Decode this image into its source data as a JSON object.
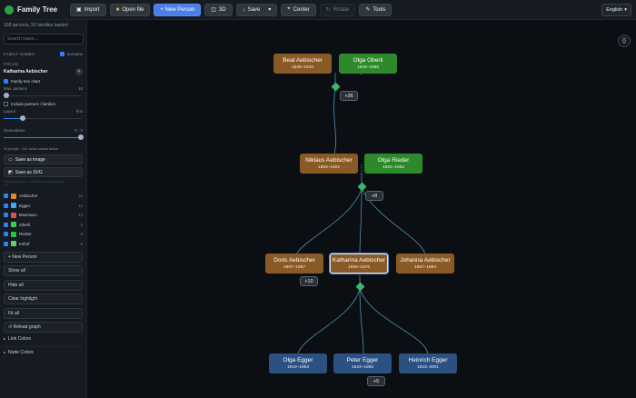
{
  "app": {
    "title": "Family Tree"
  },
  "toolbar": {
    "import": "Import",
    "open_file": "Open file",
    "new_person": "+ New Person",
    "view_3d": "3D",
    "save": "Save",
    "center": "Center",
    "disabled_btn": "Rotate",
    "tools": "Tools",
    "language": "English"
  },
  "sidebar": {
    "status": "158 persons, 50 families loaded",
    "search_placeholder": "Search name...",
    "family_names_label": "FAMILY NAMES",
    "surname_toggle": "Surname",
    "focus_label": "FOCUS",
    "focus_name": "Katharina Aebischer",
    "family_tree_chart": "Family tree chart",
    "max_persons_label": "Max. persons",
    "max_persons_value": "10",
    "include_partners": "Include partners / families",
    "layout_label": "Layout",
    "layout_value": "first",
    "generations_label": "Generations",
    "generations_value": "0 - 5",
    "filter_note": "10 people · 141 views shown below",
    "save_image": "Save as image",
    "save_svg": "Save as SVG",
    "note2": "Select persons — Ctrl/⌘ to fit some more",
    "note3": "10",
    "families": [
      {
        "name": "Aebischer",
        "color": "#e08a2e",
        "count": "22"
      },
      {
        "name": "Egger",
        "color": "#3fa9f5",
        "count": "12"
      },
      {
        "name": "Baumann",
        "color": "#d9534f",
        "count": "13"
      },
      {
        "name": "Oberli",
        "color": "#3ccf4e",
        "count": "8"
      },
      {
        "name": "Rieder",
        "color": "#2fbf3f",
        "count": "8"
      },
      {
        "name": "Imhof",
        "color": "#5ed15e",
        "count": "6"
      }
    ],
    "actions": [
      "+ New Person",
      "Show all",
      "Hide all",
      "Clear highlight",
      "Fit all",
      "↺ Reload graph"
    ],
    "link_colors": "Link Colors",
    "node_colors": "Node Colors"
  },
  "tree": {
    "people": [
      {
        "id": "beat",
        "name": "Beat Aebischer",
        "years": "1830–1910",
        "color": "brown"
      },
      {
        "id": "olga_o",
        "name": "Olga Oberli",
        "years": "1833–1895",
        "color": "green"
      },
      {
        "id": "niklaus",
        "name": "Niklaus Aebischer",
        "years": "1863–1922",
        "color": "brown"
      },
      {
        "id": "olga_r",
        "name": "Olga Rieder",
        "years": "1862–1953",
        "color": "green"
      },
      {
        "id": "doris",
        "name": "Doris Aebischer",
        "years": "1897–1957",
        "color": "brown"
      },
      {
        "id": "katharina",
        "name": "Katharina Aebischer",
        "years": "1893–1976",
        "color": "brown"
      },
      {
        "id": "johanna",
        "name": "Johanna Aebischer",
        "years": "1897–1984",
        "color": "brown"
      },
      {
        "id": "olga_e",
        "name": "Olga Egger",
        "years": "1919–1993",
        "color": "blue"
      },
      {
        "id": "peter",
        "name": "Peter Egger",
        "years": "1923–1985",
        "color": "blue"
      },
      {
        "id": "heinrich",
        "name": "Heinrich Egger",
        "years": "1923–2001",
        "color": "blue"
      }
    ],
    "badges": [
      "+36",
      "+8",
      "+10",
      "+5"
    ]
  }
}
